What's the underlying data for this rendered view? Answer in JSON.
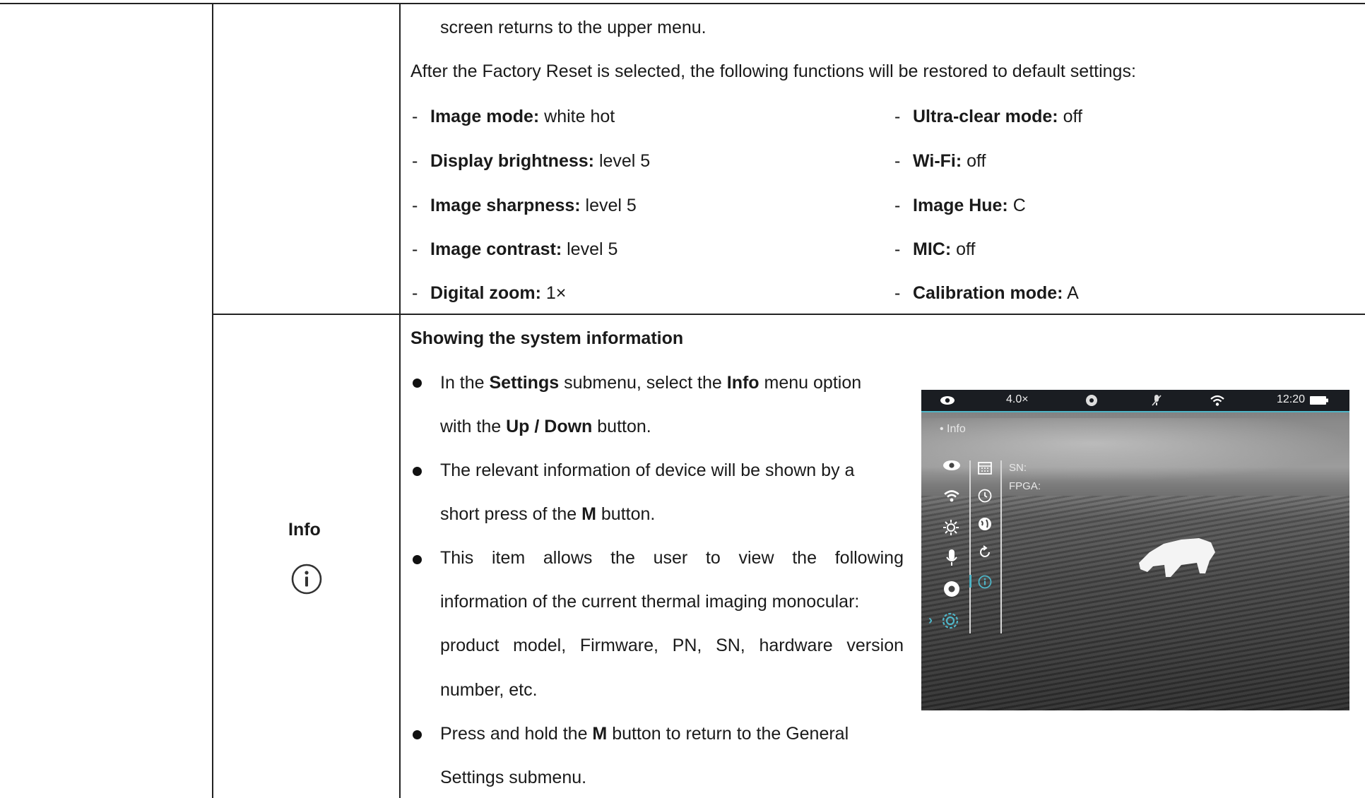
{
  "reset": {
    "continued_text": "screen returns to the upper menu.",
    "intro": "After the Factory Reset is selected, the following functions will be restored to default settings:",
    "left_items": [
      {
        "dash": "-",
        "label": "Image mode:",
        "value": " white hot"
      },
      {
        "dash": "-",
        "label": "Display brightness:",
        "value": " level 5"
      },
      {
        "dash": "-",
        "label": "Image sharpness:",
        "value": " level 5"
      },
      {
        "dash": "-",
        "label": "Image contrast:",
        "value": " level 5"
      },
      {
        "dash": "-",
        "label": "Digital zoom:",
        "value": " 1×"
      }
    ],
    "right_items": [
      {
        "dash": "-",
        "label": "Ultra-clear mode:",
        "value": " off"
      },
      {
        "dash": "-",
        "label": "Wi-Fi:",
        "value": " off"
      },
      {
        "dash": "-",
        "label": "Image Hue:",
        "value": " C"
      },
      {
        "dash": "-",
        "label": "MIC:",
        "value": " off"
      },
      {
        "dash": "-",
        "label": "Calibration mode:",
        "value": " A"
      }
    ]
  },
  "info_row": {
    "name": "Info",
    "icon": "info-circle-icon",
    "heading": "Showing the system information",
    "b1": {
      "t1": "In the ",
      "t2": "Settings",
      "t3": " submenu, select the ",
      "t4": "Info",
      "t5": " menu option",
      "t6": "with the ",
      "t7": "Up / Down",
      "t8": " button."
    },
    "b2": {
      "t1": "The relevant information of device will be shown by a",
      "t2": "short press of the ",
      "t3": "M",
      "t4": " button."
    },
    "b3": {
      "l1": "This item allows the user to view the following",
      "l2": "information of the current thermal imaging monocular:",
      "l3": "product model, Firmware, PN, SN, hardware version",
      "l4": "number, etc."
    },
    "b4": {
      "t1": "Press and hold the ",
      "t2": "M",
      "t3": " button to return to the General",
      "t4": "Settings submenu."
    }
  },
  "device_screen": {
    "zoom": "4.0×",
    "time": "12:20",
    "menu_title": "• Info",
    "sn_label": "SN:",
    "fpga_label": "FPGA:",
    "accent": "#4fb6c8"
  }
}
